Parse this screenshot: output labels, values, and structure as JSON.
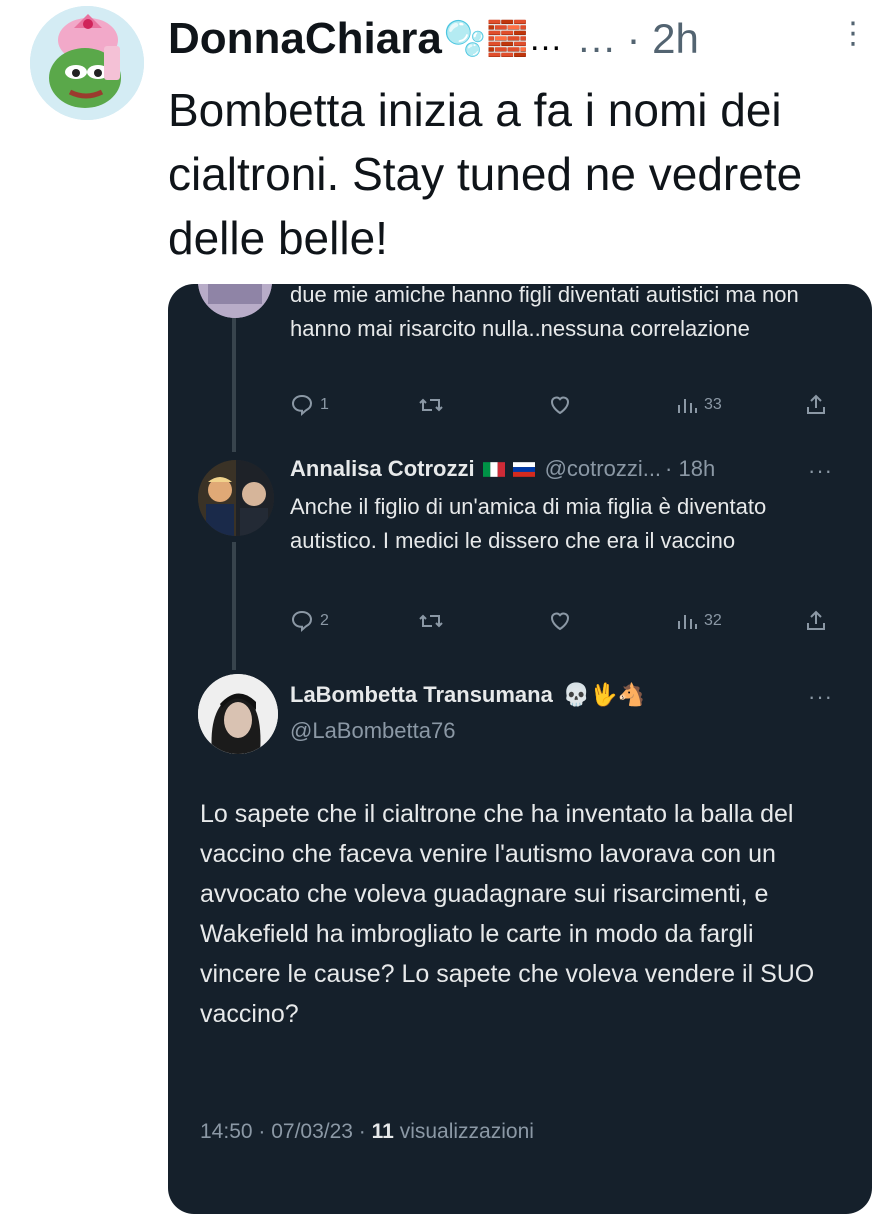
{
  "outer": {
    "display_name": "DonnaChiara",
    "name_emoji": "🫧🧱…",
    "ellipsis": "…",
    "time": "· 2h",
    "more": "⋮",
    "text": "Bombetta inizia a fa i nomi dei cialtroni. Stay tuned ne vedrete delle belle!"
  },
  "embedded": {
    "reply1": {
      "text": "due mie amiche hanno figli diventati autistici ma non hanno mai risarcito nulla..nessuna correlazione",
      "replies": "1",
      "views": "33"
    },
    "reply2": {
      "name": "Annalisa Cotrozzi",
      "flags": [
        "italy-flag",
        "russia-flag"
      ],
      "handle": "@cotrozzi...",
      "time": "· 18h",
      "more": "···",
      "text": "Anche il figlio di un'amica di mia figlia è diventato autistico. I medici le dissero che era il vaccino",
      "replies": "2",
      "views": "32"
    },
    "main": {
      "name": "LaBombetta Transumana",
      "emoji": "💀🖖🐴",
      "handle": "@LaBombetta76",
      "more": "···",
      "text": "Lo sapete che il cialtrone che ha inventato la balla del vaccino che faceva venire l'autismo lavorava con un avvocato che voleva guadagnare sui risarcimenti, e Wakefield ha imbrogliato le carte in modo da fargli vincere le cause? Lo sapete che voleva vendere il SUO vaccino?",
      "timestamp": "14:50 · 07/03/23 ·",
      "views_count": "11",
      "views_label": "visualizzazioni"
    }
  },
  "colors": {
    "dark_bg": "#15202b",
    "dark_text": "#e7e9ea",
    "dark_muted": "#8b98a5",
    "light_text": "#0f1419",
    "light_muted": "#536471"
  }
}
